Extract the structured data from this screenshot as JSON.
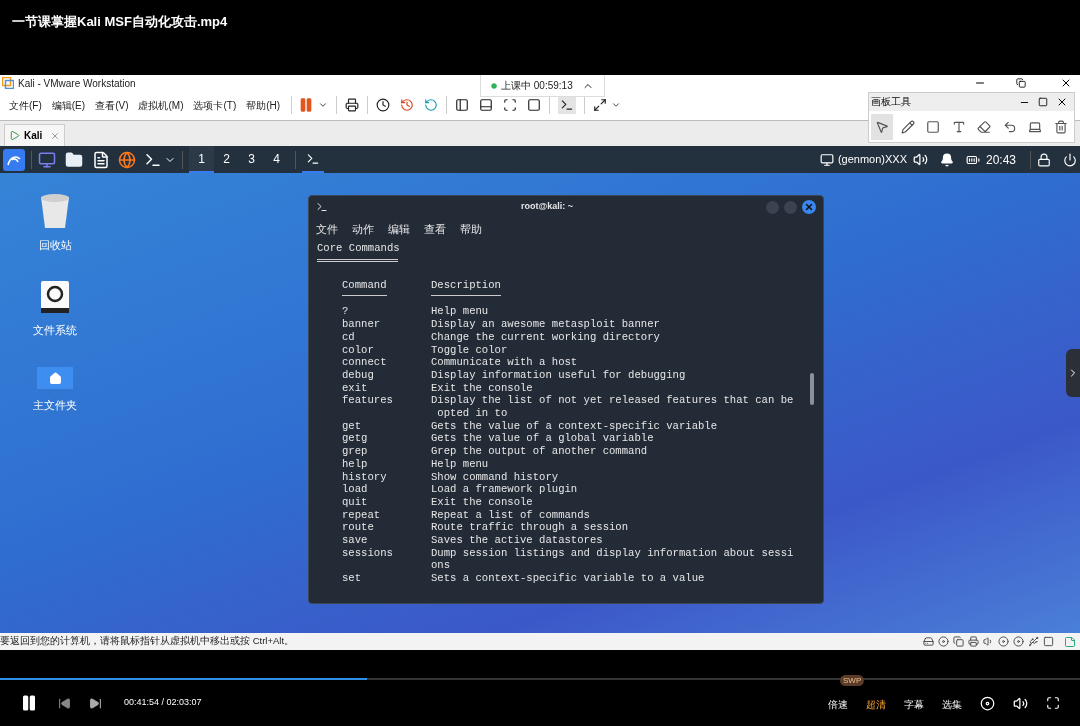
{
  "video_title": "一节课掌握Kali MSF自动化攻击.mp4",
  "vmware": {
    "title": "Kali - VMware Workstation",
    "menu": [
      "文件(F)",
      "编辑(E)",
      "查看(V)",
      "虚拟机(M)",
      "选项卡(T)",
      "帮助(H)"
    ],
    "class_timer": "上课中 00:59:13",
    "tab": "Kali"
  },
  "drawing_panel": {
    "title": "画板工具",
    "tools": [
      {
        "kind": "pointer",
        "selected": true
      },
      {
        "kind": "pen",
        "selected": false
      },
      {
        "kind": "rect",
        "selected": false
      },
      {
        "kind": "text",
        "selected": false
      },
      {
        "kind": "eraser",
        "selected": false
      },
      {
        "kind": "undo",
        "selected": false
      },
      {
        "kind": "screen",
        "selected": false
      },
      {
        "kind": "trash",
        "selected": false
      }
    ]
  },
  "kali_panel": {
    "workspaces": [
      {
        "label": "1",
        "selected": true
      },
      {
        "label": "2",
        "selected": false
      },
      {
        "label": "3",
        "selected": false
      },
      {
        "label": "4",
        "selected": false
      }
    ],
    "genmon": "(genmon)XXX",
    "clock": "20:43"
  },
  "desktop_icons": [
    {
      "kind": "trash",
      "label": "回收站"
    },
    {
      "kind": "drive",
      "label": "文件系统"
    },
    {
      "kind": "home",
      "label": "主文件夹"
    }
  ],
  "terminal": {
    "title": "root@kali: ~",
    "menu": [
      "文件",
      "动作",
      "编辑",
      "查看",
      "帮助"
    ],
    "section": "Core Commands",
    "headers": [
      "Command",
      "Description"
    ],
    "rows": [
      {
        "command": "?",
        "description": [
          "Help menu"
        ]
      },
      {
        "command": "banner",
        "description": [
          "Display an awesome metasploit banner"
        ]
      },
      {
        "command": "cd",
        "description": [
          "Change the current working directory"
        ]
      },
      {
        "command": "color",
        "description": [
          "Toggle color"
        ]
      },
      {
        "command": "connect",
        "description": [
          "Communicate with a host"
        ]
      },
      {
        "command": "debug",
        "description": [
          "Display information useful for debugging"
        ]
      },
      {
        "command": "exit",
        "description": [
          "Exit the console"
        ]
      },
      {
        "command": "features",
        "description": [
          "Display the list of not yet released features that can be",
          " opted in to"
        ]
      },
      {
        "command": "get",
        "description": [
          "Gets the value of a context-specific variable"
        ]
      },
      {
        "command": "getg",
        "description": [
          "Gets the value of a global variable"
        ]
      },
      {
        "command": "grep",
        "description": [
          "Grep the output of another command"
        ]
      },
      {
        "command": "help",
        "description": [
          "Help menu"
        ]
      },
      {
        "command": "history",
        "description": [
          "Show command history"
        ]
      },
      {
        "command": "load",
        "description": [
          "Load a framework plugin"
        ]
      },
      {
        "command": "quit",
        "description": [
          "Exit the console"
        ]
      },
      {
        "command": "repeat",
        "description": [
          "Repeat a list of commands"
        ]
      },
      {
        "command": "route",
        "description": [
          "Route traffic through a session"
        ]
      },
      {
        "command": "save",
        "description": [
          "Saves the active datastores"
        ]
      },
      {
        "command": "sessions",
        "description": [
          "Dump session listings and display information about sessi",
          "ons"
        ]
      },
      {
        "command": "set",
        "description": [
          "Sets a context-specific variable to a value"
        ]
      }
    ]
  },
  "status_bar": "要返回到您的计算机，请将鼠标指针从虚拟机中移出或按 Ctrl+Alt。",
  "player": {
    "level": 0.34,
    "time": "00:41:54 / 02:03:07",
    "options": [
      {
        "label": "倍速",
        "badge": "SWP",
        "selected": false
      },
      {
        "label": "超清",
        "selected": true
      },
      {
        "label": "字幕",
        "selected": false
      },
      {
        "label": "选集",
        "selected": false
      }
    ]
  }
}
